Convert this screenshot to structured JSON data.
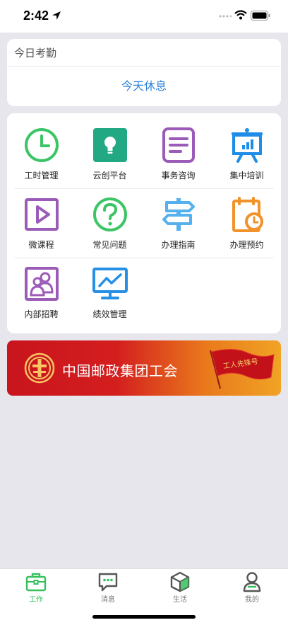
{
  "status_bar": {
    "time": "2:42"
  },
  "attendance": {
    "title": "今日考勤",
    "status": "今天休息"
  },
  "grid": {
    "rows": [
      [
        {
          "label": "工时管理",
          "icon": "clock-icon"
        },
        {
          "label": "云创平台",
          "icon": "lightbulb-icon"
        },
        {
          "label": "事务咨询",
          "icon": "document-icon"
        },
        {
          "label": "集中培训",
          "icon": "presentation-board-icon"
        }
      ],
      [
        {
          "label": "微课程",
          "icon": "play-icon"
        },
        {
          "label": "常见问题",
          "icon": "question-icon"
        },
        {
          "label": "办理指南",
          "icon": "signpost-icon"
        },
        {
          "label": "办理预约",
          "icon": "calendar-clock-icon"
        }
      ],
      [
        {
          "label": "内部招聘",
          "icon": "people-icon"
        },
        {
          "label": "绩效管理",
          "icon": "monitor-chart-icon"
        }
      ]
    ]
  },
  "banner": {
    "title": "中国邮政集团工会",
    "flag_text": "工人先锋号"
  },
  "tab_bar": {
    "tabs": [
      {
        "label": "工作",
        "icon": "briefcase-icon",
        "active": true
      },
      {
        "label": "消息",
        "icon": "chat-icon",
        "active": false
      },
      {
        "label": "生活",
        "icon": "cube-icon",
        "active": false
      },
      {
        "label": "我的",
        "icon": "person-icon",
        "active": false
      }
    ]
  },
  "colors": {
    "accent_blue": "#2a82d9",
    "active_green": "#35c05c",
    "banner_red": "#c8141d"
  }
}
